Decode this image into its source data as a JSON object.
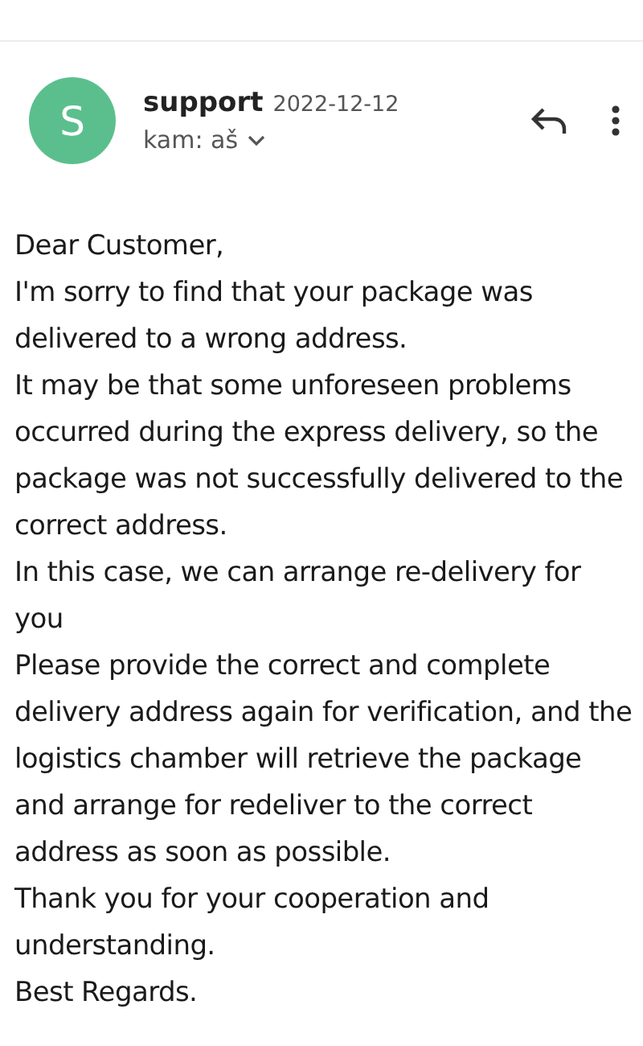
{
  "message": {
    "avatar": {
      "letter": "S",
      "color": "#5bbf8d"
    },
    "sender": "support",
    "date": "2022-12-12",
    "recipient": "kam: aš",
    "body": [
      "Dear Customer,",
      "I'm sorry to find that your package was delivered to a wrong address.",
      "It may be that some unforeseen problems occurred during the express delivery, so the package was not successfully delivered to the correct address.",
      "In this case, we can arrange re-delivery for you",
      "Please provide the correct and complete delivery address again for verification, and the logistics chamber will retrieve the package and arrange for redeliver to the correct address as soon as possible.",
      "Thank you for your cooperation and understanding.",
      "Best Regards."
    ]
  }
}
